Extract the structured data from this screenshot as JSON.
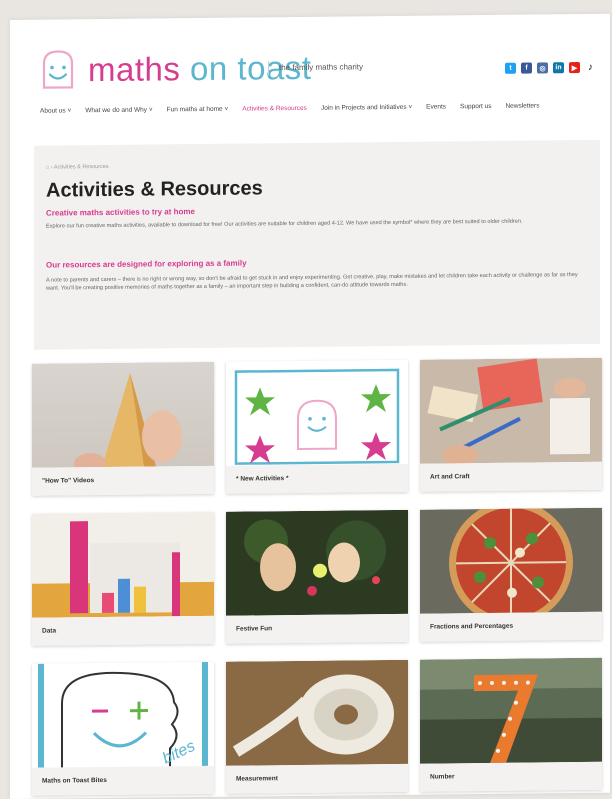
{
  "header": {
    "logo_part1": "maths ",
    "logo_part2": "on toast",
    "tagline": "the family maths charity",
    "social_icons": [
      "twitter-icon",
      "facebook-icon",
      "instagram-icon",
      "linkedin-icon",
      "youtube-icon",
      "tiktok-icon"
    ]
  },
  "nav": {
    "items": [
      {
        "label": "About us ˅"
      },
      {
        "label": "What we do and Why ˅"
      },
      {
        "label": "Fun maths at home ˅"
      },
      {
        "label": "Activities & Resources"
      },
      {
        "label": "Join in Projects and Initiatives ˅"
      },
      {
        "label": "Events"
      },
      {
        "label": "Support us"
      },
      {
        "label": "Newsletters"
      }
    ]
  },
  "content": {
    "breadcrumb": "⌂ › Activities & Resources",
    "title": "Activities & Resources",
    "subtitle1": "Creative maths activities to try at home",
    "para1": "Explore our fun creative maths activities, available to download for free! Our activities are suitable for children aged 4-12. We have used the symbol* where they are best suited to older children.",
    "subtitle2": "Our resources are designed for exploring as a family",
    "para2": "A note to parents and carers – there is no right or wrong way, so don't be afraid to get stuck in and enjoy experimenting. Get creative, play, make mistakes and let children take each activity or challenge as far as they want. You'll be creating positive memories of maths together as a family – an important step in building a confident, can-do attitude towards maths."
  },
  "cards": [
    {
      "label": "\"How To\" Videos"
    },
    {
      "label": "* New Activities *"
    },
    {
      "label": "Art and Craft"
    },
    {
      "label": "Data"
    },
    {
      "label": "Festive Fun"
    },
    {
      "label": "Fractions and Percentages"
    },
    {
      "label": "Maths on Toast Bites"
    },
    {
      "label": "Measurement"
    },
    {
      "label": "Number"
    }
  ],
  "bites_word": "bites",
  "colors": {
    "pink": "#d63c8f",
    "blue": "#5bb6d0",
    "green": "#5fb544"
  }
}
